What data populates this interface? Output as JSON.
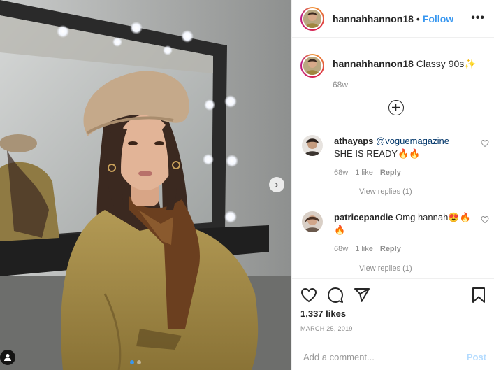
{
  "post": {
    "username": "hannahhannon18",
    "follow_label": "Follow",
    "more_label": "•••",
    "caption": {
      "username": "hannahhannon18",
      "text": "Classy 90s",
      "emoji": "✨",
      "time": "68w"
    },
    "likes": "1,337 likes",
    "date": "MARCH 25, 2019",
    "carousel": {
      "current_slide": 1,
      "total_slides": 2
    }
  },
  "comments": [
    {
      "username": "athayaps",
      "mention": "@voguemagazine",
      "text": "SHE IS READY🔥🔥",
      "time": "68w",
      "likes": "1 like",
      "reply_label": "Reply",
      "view_replies": "View replies (1)"
    },
    {
      "username": "patricepandie",
      "text": "Omg hannah😍🔥🔥",
      "time": "68w",
      "likes": "1 like",
      "reply_label": "Reply",
      "view_replies": "View replies (1)"
    }
  ],
  "add_comment": {
    "placeholder": "Add a comment...",
    "post_label": "Post"
  },
  "icons": {
    "heart": "heart-icon",
    "comment": "comment-icon",
    "share": "share-icon",
    "save": "bookmark-icon",
    "load_more": "plus-circle-icon",
    "next": "chevron-right-icon",
    "tag": "user-tag-icon"
  },
  "colors": {
    "link": "#3897f0",
    "mention": "#003569",
    "muted": "#8e8e8e",
    "post_disabled": "#b3dbff"
  }
}
